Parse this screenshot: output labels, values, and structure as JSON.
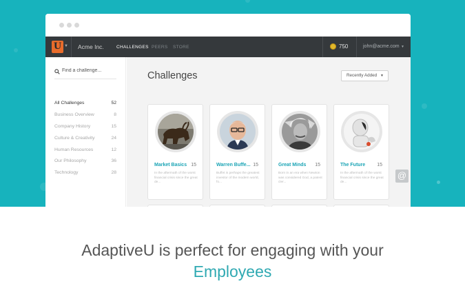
{
  "browser": {},
  "nav": {
    "logo_letter": "U",
    "company": "Acme Inc.",
    "tabs": [
      "CHALLENGES",
      "PEERS",
      "STORE"
    ],
    "active_tab": "CHALLENGES",
    "points": "750",
    "user_email": "john@acme.com"
  },
  "sidebar": {
    "search_placeholder": "Find a challenge...",
    "categories": [
      {
        "label": "All Challenges",
        "count": "52",
        "active": true
      },
      {
        "label": "Business Overview",
        "count": "8"
      },
      {
        "label": "Company History",
        "count": "15"
      },
      {
        "label": "Culture & Creativity",
        "count": "24"
      },
      {
        "label": "Human Resources",
        "count": "12"
      },
      {
        "label": "Our Philosophy",
        "count": "36"
      },
      {
        "label": "Technology",
        "count": "28"
      }
    ]
  },
  "main": {
    "title": "Challenges",
    "sort_label": "Recently Added",
    "cards": [
      {
        "title": "Market Basics",
        "count": "15",
        "description": "In the aftermath of the worst financial crisis since the great de...",
        "image": "bull-statue"
      },
      {
        "title": "Warren Buffe...",
        "count": "15",
        "description": "Buffet is perhaps the greatest investor of the modern world, fo...",
        "image": "portrait"
      },
      {
        "title": "Great Minds",
        "count": "15",
        "description": "Born in an era when Newton was considered God, a patent cler...",
        "image": "portrait-bw"
      },
      {
        "title": "The Future",
        "count": "15",
        "description": "In the aftermath of the worst financial crisis since the great de...",
        "image": "robot"
      }
    ]
  },
  "badge": {
    "symbol": "@"
  },
  "tagline": {
    "line1": "AdaptiveU is perfect for engaging with your",
    "line2": "Employees"
  },
  "colors": {
    "accent": "#17b3bd",
    "navbar": "#35393c",
    "logo": "#e96c2b",
    "link": "#1aa4b5"
  }
}
